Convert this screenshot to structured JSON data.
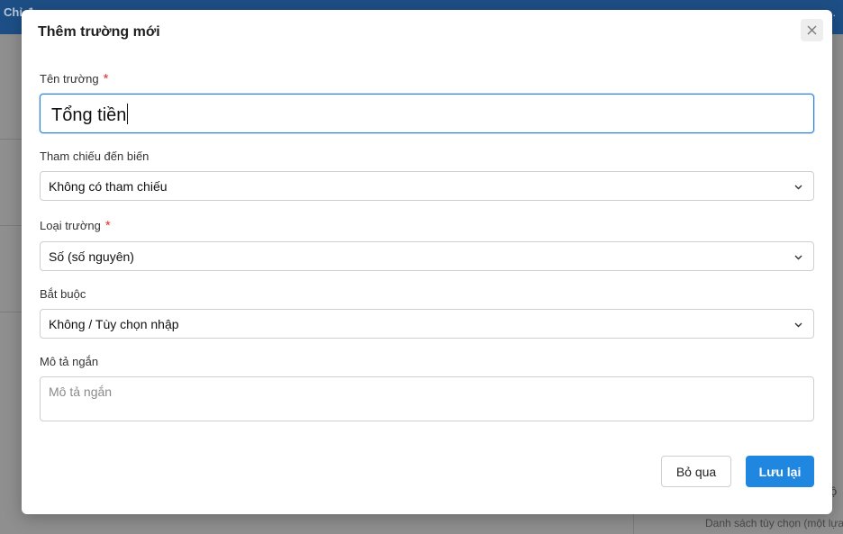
{
  "background": {
    "topbar_left": "Chỉ đ...",
    "topbar_right": "...",
    "right_panel_text": "Danh sách tùy chọn (một lựa",
    "edge_text": "ộ"
  },
  "modal": {
    "title": "Thêm trường mới",
    "close_icon": "close-icon",
    "fields": {
      "name": {
        "label": "Tên trường",
        "required_mark": "*",
        "value": "Tổng tiền"
      },
      "reference": {
        "label": "Tham chiếu đến biến",
        "value": "Không có tham chiếu"
      },
      "type": {
        "label": "Loại trường",
        "required_mark": "*",
        "value": "Số (số nguyên)"
      },
      "required": {
        "label": "Bắt buộc",
        "value": "Không / Tùy chọn nhập"
      },
      "description": {
        "label": "Mô tả ngắn",
        "placeholder": "Mô tả ngắn",
        "value": ""
      }
    },
    "buttons": {
      "cancel": "Bỏ qua",
      "save": "Lưu lại"
    }
  },
  "colors": {
    "primary": "#1f87e0",
    "required": "#e03131",
    "header": "#1d4f86"
  }
}
